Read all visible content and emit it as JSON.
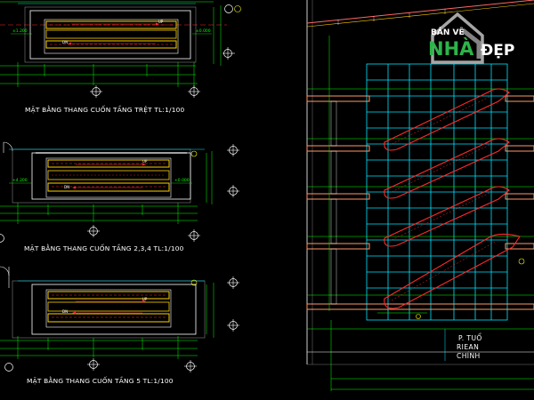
{
  "plans": [
    {
      "title": "MẶT BẰNG THANG CUỐN TẦNG TRỆT TL:1/100",
      "up_label": "UP",
      "dn_label": "DN",
      "level_left": "±1.200",
      "level_right": "±0.000"
    },
    {
      "title": "MẶT BẰNG THANG CUỐN TẦNG 2,3,4 TL:1/100",
      "up_label": "UP",
      "dn_label": "DN",
      "level_left": "+4.200",
      "level_right": "+0.000"
    },
    {
      "title": "MẶT BẰNG THANG CUỐN TẦNG 5 TL:1/100",
      "up_label": "UP",
      "dn_label": "DN"
    }
  ],
  "section": {
    "label_lines": [
      "P. TUỔ",
      "RIEAN",
      "CHÍNH"
    ]
  },
  "logo": {
    "line1": "BẢN VẼ",
    "line2": "NHÀ",
    "line3": "ĐẸP",
    "accent": "#2db34a",
    "shape_color": "#b7b7b7"
  },
  "colors": {
    "background": "#000000",
    "frame": "#ffffff",
    "dimension": "#00ff00",
    "grid": "#00e5ff",
    "escalator": "#ff2a2a",
    "slab": "#ff9966",
    "marker": "#ffff00"
  }
}
